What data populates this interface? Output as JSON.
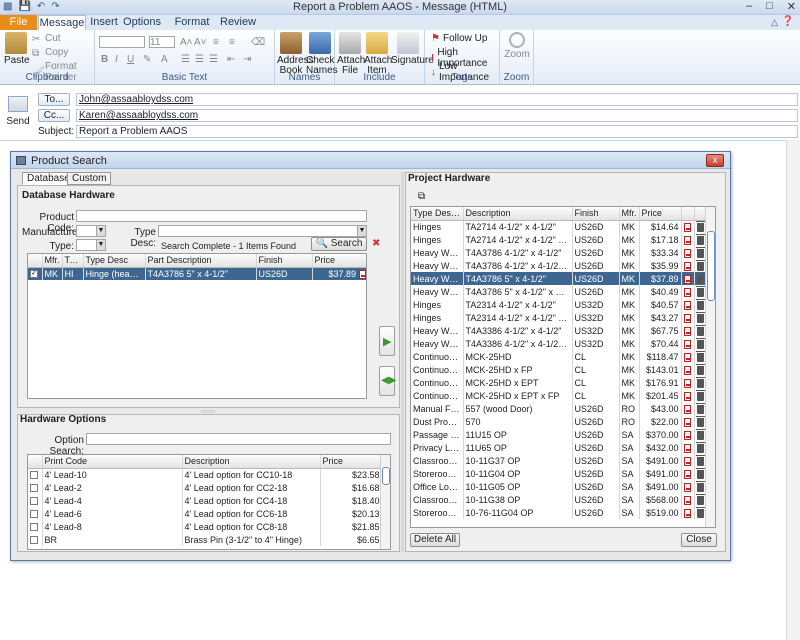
{
  "window": {
    "title": "Report a Problem AAOS - Message (HTML)"
  },
  "ribbon_tabs": [
    "File",
    "Message",
    "Insert",
    "Options",
    "Format Text",
    "Review"
  ],
  "ribbon": {
    "clipboard": {
      "label": "Clipboard",
      "paste": "Paste",
      "cut": "Cut",
      "copy": "Copy",
      "format_painter": "Format Painter"
    },
    "basic_text": {
      "label": "Basic Text",
      "font_size": "11"
    },
    "names": {
      "label": "Names",
      "address_book": "Address Book",
      "check_names": "Check Names"
    },
    "include": {
      "label": "Include",
      "attach_file": "Attach File",
      "attach_item": "Attach Item",
      "signature": "Signature"
    },
    "tags": {
      "label": "Tags",
      "follow_up": "Follow Up",
      "high_importance": "High Importance",
      "low_importance": "Low Importance"
    },
    "zoom": {
      "label": "Zoom",
      "zoom": "Zoom"
    }
  },
  "envelope": {
    "send": "Send",
    "to_label": "To...",
    "to_value": "John@assaabloydss.com",
    "cc_label": "Cc...",
    "cc_value": "Karen@assaabloydss.com",
    "subject_label": "Subject:",
    "subject_value": "Report a Problem AAOS"
  },
  "dialog": {
    "title": "Product Search",
    "close": "x",
    "tabs": [
      "Database",
      "Custom"
    ],
    "database_hardware": "Database Hardware",
    "product_code_label": "Product Code:",
    "manufacturer_label": "Manufacturer:",
    "type_desc_label": "Type Desc:",
    "type_label": "Type:",
    "search_status": "Search Complete - 1 Items Found",
    "search_button": "Search",
    "db_columns": [
      "",
      "Mfr.",
      "Type",
      "Type Desc",
      "Part Description",
      "Finish",
      "Price"
    ],
    "db_rows": [
      {
        "mfr": "MK",
        "type": "HI",
        "type_desc": "Hinge (heavy w...",
        "part": "T4A3786 5\" x 4-1/2\"",
        "finish": "US26D",
        "price": "$37.89"
      }
    ],
    "hardware_options": "Hardware Options",
    "option_search_label": "Option Search:",
    "opt_columns": [
      "",
      "Print Code",
      "Description",
      "Price"
    ],
    "opt_rows": [
      {
        "code": "4' Lead-10",
        "desc": "4' Lead option for CC10-18",
        "price": "$23.58"
      },
      {
        "code": "4' Lead-2",
        "desc": "4' Lead option for CC2-18",
        "price": "$16.68"
      },
      {
        "code": "4' Lead-4",
        "desc": "4' Lead option for CC4-18",
        "price": "$18.40"
      },
      {
        "code": "4' Lead-6",
        "desc": "4' Lead option for CC6-18",
        "price": "$20.13"
      },
      {
        "code": "4' Lead-8",
        "desc": "4' Lead option for CC8-18",
        "price": "$21.85"
      },
      {
        "code": "BR",
        "desc": "Brass Pin (3-1/2\" to 4\" Hinge)",
        "price": "$6.65"
      }
    ],
    "project_hardware": "Project Hardware",
    "proj_columns": [
      "Type Descrip...",
      "Description",
      "Finish",
      "Mfr.",
      "Price"
    ],
    "proj_rows": [
      {
        "type": "Hinges",
        "desc": "TA2714 4-1/2\" x 4-1/2\"",
        "finish": "US26D",
        "mfr": "MK",
        "price": "$14.64"
      },
      {
        "type": "Hinges",
        "desc": "TA2714 4-1/2\" x 4-1/2\" x NRP",
        "finish": "US26D",
        "mfr": "MK",
        "price": "$17.18"
      },
      {
        "type": "Heavy Weig...",
        "desc": "T4A3786 4-1/2\" x 4-1/2\"",
        "finish": "US26D",
        "mfr": "MK",
        "price": "$33.34"
      },
      {
        "type": "Heavy Weig...",
        "desc": "T4A3786 4-1/2\" x 4-1/2\" x NRP",
        "finish": "US26D",
        "mfr": "MK",
        "price": "$35.99"
      },
      {
        "type": "Heavy Weig...",
        "desc": "T4A3786 5\" x 4-1/2\"",
        "finish": "US26D",
        "mfr": "MK",
        "price": "$37.89"
      },
      {
        "type": "Heavy Weig...",
        "desc": "T4A3786 5\" x 4-1/2\" x NRP",
        "finish": "US26D",
        "mfr": "MK",
        "price": "$40.49"
      },
      {
        "type": "Hinges",
        "desc": "TA2314 4-1/2\" x 4-1/2\"",
        "finish": "US32D",
        "mfr": "MK",
        "price": "$40.57"
      },
      {
        "type": "Hinges",
        "desc": "TA2314 4-1/2\" x 4-1/2\" x NRP",
        "finish": "US32D",
        "mfr": "MK",
        "price": "$43.27"
      },
      {
        "type": "Heavy Weig...",
        "desc": "T4A3386 4-1/2\" x 4-1/2\"",
        "finish": "US32D",
        "mfr": "MK",
        "price": "$67.75"
      },
      {
        "type": "Heavy Weig...",
        "desc": "T4A3386 4-1/2\" x 4-1/2\" x NRP",
        "finish": "US32D",
        "mfr": "MK",
        "price": "$70.44"
      },
      {
        "type": "Continuous ...",
        "desc": "MCK-25HD",
        "finish": "CL",
        "mfr": "MK",
        "price": "$118.47"
      },
      {
        "type": "Continuous ...",
        "desc": "MCK-25HD x FP",
        "finish": "CL",
        "mfr": "MK",
        "price": "$143.01"
      },
      {
        "type": "Continuous ...",
        "desc": "MCK-25HD x EPT",
        "finish": "CL",
        "mfr": "MK",
        "price": "$176.91"
      },
      {
        "type": "Continuous ...",
        "desc": "MCK-25HD x EPT x FP",
        "finish": "CL",
        "mfr": "MK",
        "price": "$201.45"
      },
      {
        "type": "Manual Flush...",
        "desc": "557 (wood Door)",
        "finish": "US26D",
        "mfr": "RO",
        "price": "$43.00"
      },
      {
        "type": "Dust Proof S...",
        "desc": "570",
        "finish": "US26D",
        "mfr": "RO",
        "price": "$22.00"
      },
      {
        "type": "Passage Lat...",
        "desc": "11U15 OP",
        "finish": "US26D",
        "mfr": "SA",
        "price": "$370.00"
      },
      {
        "type": "Privacy Lockset",
        "desc": "11U65 OP",
        "finish": "US26D",
        "mfr": "SA",
        "price": "$432.00"
      },
      {
        "type": "Classroom L...",
        "desc": "10-11G37 OP",
        "finish": "US26D",
        "mfr": "SA",
        "price": "$491.00"
      },
      {
        "type": "Storeroom L...",
        "desc": "10-11G04 OP",
        "finish": "US26D",
        "mfr": "SA",
        "price": "$491.00"
      },
      {
        "type": "Office Lockset",
        "desc": "10-11G05 OP",
        "finish": "US26D",
        "mfr": "SA",
        "price": "$491.00"
      },
      {
        "type": "Classroom S...",
        "desc": "10-11G38 OP",
        "finish": "US26D",
        "mfr": "SA",
        "price": "$568.00"
      },
      {
        "type": "Storeroom L...",
        "desc": "10-76-11G04 OP",
        "finish": "US26D",
        "mfr": "SA",
        "price": "$519.00"
      }
    ],
    "delete_all": "Delete All",
    "close_button": "Close"
  },
  "colors": {
    "selection": "#3d6791",
    "file_tab": "#e88c1a"
  }
}
